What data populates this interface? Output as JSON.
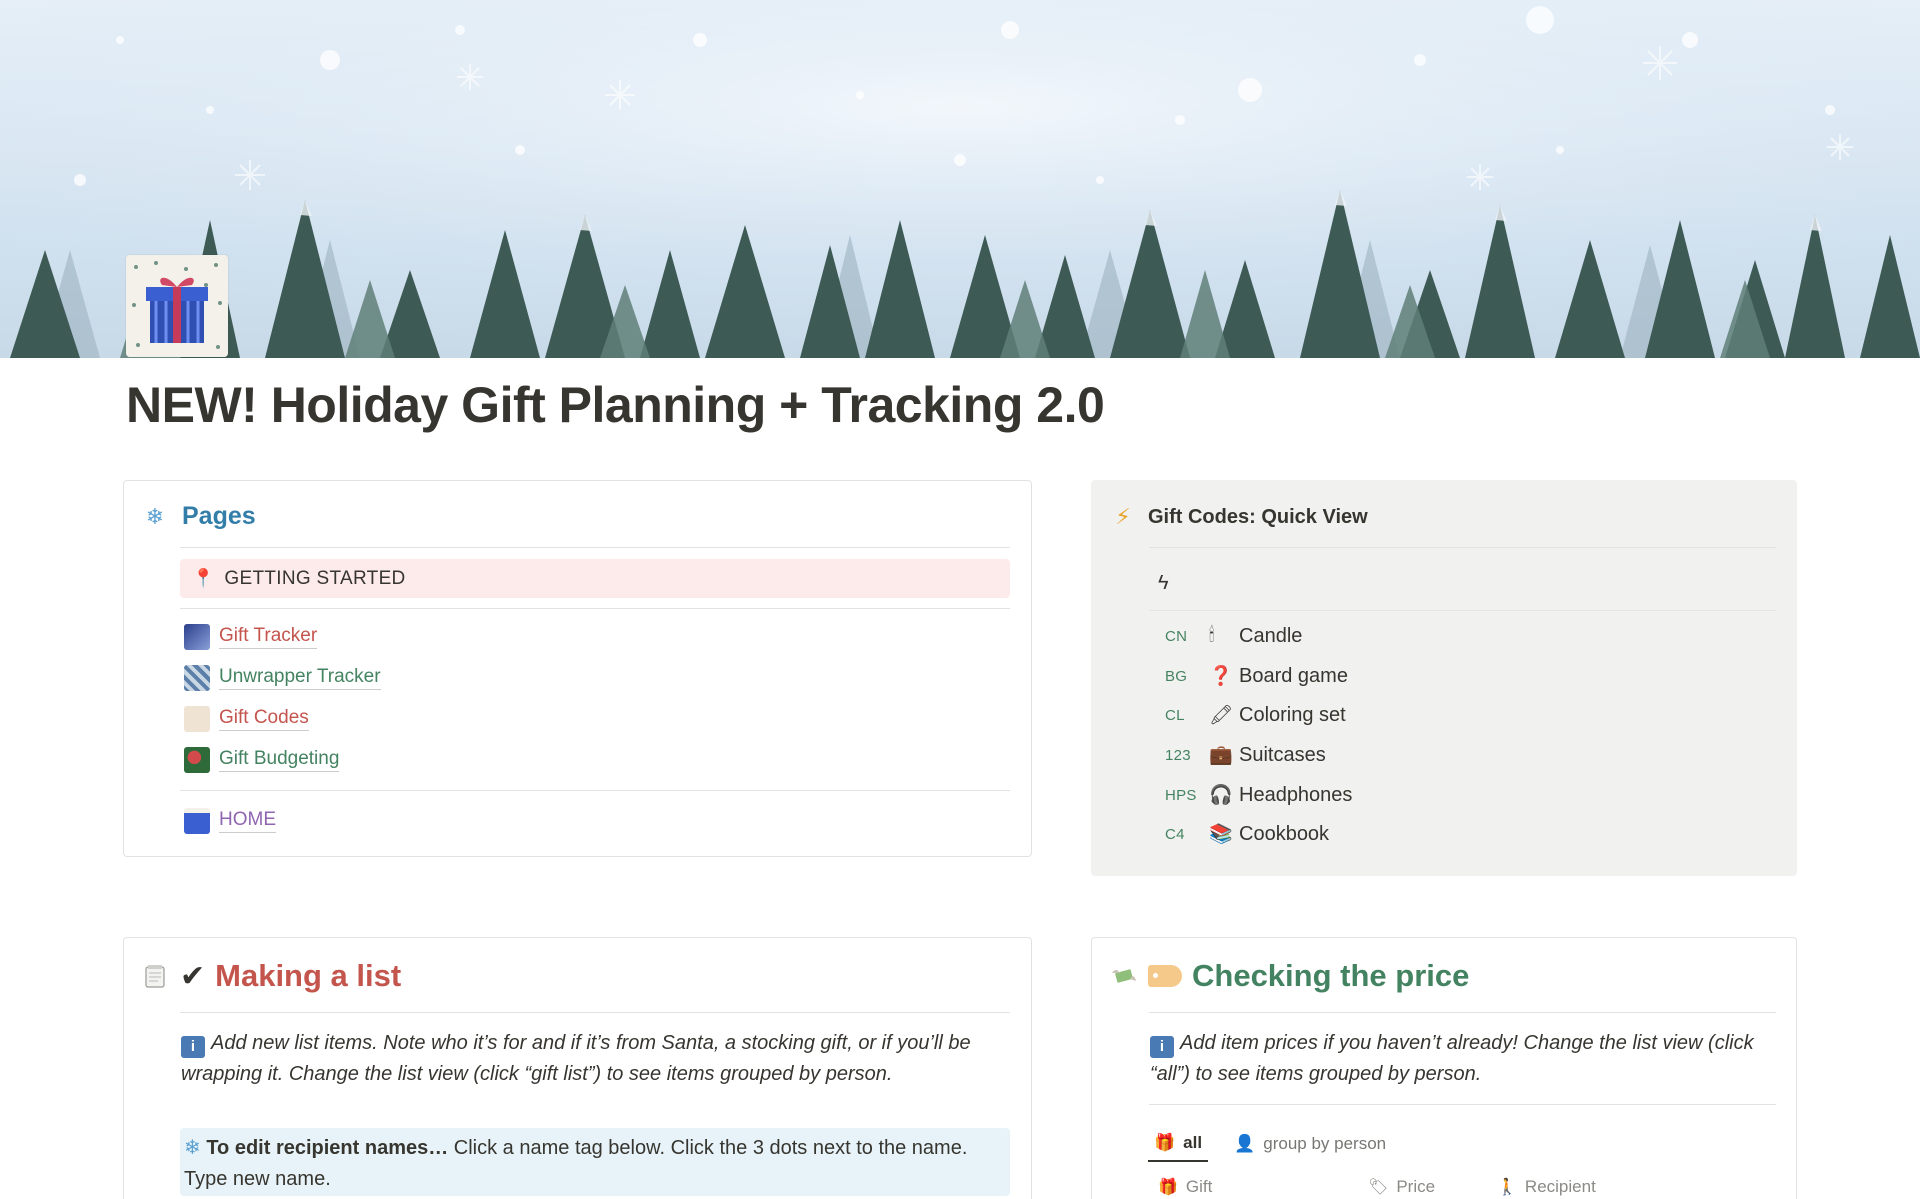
{
  "page": {
    "title": "NEW! Holiday Gift Planning + Tracking 2.0",
    "icon": "gift-icon"
  },
  "pages_card": {
    "title": "Pages",
    "icon": "snowflake-icon",
    "getting_started": "GETTING STARTED",
    "links": [
      {
        "label": "Gift Tracker",
        "icon": "gift-tracker-thumb-icon",
        "color": "#c4554d"
      },
      {
        "label": "Unwrapper Tracker",
        "icon": "unwrapper-thumb-icon",
        "color": "#448361"
      },
      {
        "label": "Gift Codes",
        "icon": "gift-codes-thumb-icon",
        "color": "#c4554d"
      },
      {
        "label": "Gift Budgeting",
        "icon": "gift-budgeting-thumb-icon",
        "color": "#448361"
      }
    ],
    "home": "HOME"
  },
  "codes_card": {
    "title": "Gift Codes: Quick View",
    "icon": "lightning-icon",
    "rows": [
      {
        "code": "CN",
        "emoji": "🕯",
        "icon": "candle-icon",
        "name": "Candle"
      },
      {
        "code": "BG",
        "emoji": "❓",
        "icon": "question-icon",
        "name": "Board game"
      },
      {
        "code": "CL",
        "emoji": "🖍",
        "icon": "crayon-icon",
        "name": "Coloring set"
      },
      {
        "code": "123",
        "emoji": "💼",
        "icon": "suitcase-icon",
        "name": "Suitcases"
      },
      {
        "code": "HPS",
        "emoji": "🎧",
        "icon": "headphones-icon",
        "name": "Headphones"
      },
      {
        "code": "C4",
        "emoji": "📚",
        "icon": "books-icon",
        "name": "Cookbook"
      }
    ]
  },
  "list_card": {
    "title": "Making a list",
    "check": "✔",
    "info_badge": "i",
    "note": "Add new list items. Note who it’s for and if it’s from Santa, a stocking gift, or if you’ll be wrapping it. Change the list view (click “gift list”) to see items grouped by person.",
    "callout_bold": "To edit recipient names…",
    "callout_text": " Click a name tag below. Click the 3 dots next to the name. Type new name."
  },
  "price_card": {
    "title": "Checking the price",
    "info_badge": "i",
    "note": "Add item prices if you haven’t already! Change the list view (click “all”) to see items grouped by person.",
    "tabs": [
      {
        "label": "all",
        "icon": "gift-icon",
        "active": true
      },
      {
        "label": "group by person",
        "icon": "person-icon",
        "active": false
      }
    ],
    "columns": [
      {
        "label": "Gift",
        "icon": "gift-column-icon"
      },
      {
        "label": "Price",
        "icon": "tag-icon"
      },
      {
        "label": "Recipient",
        "icon": "person-walking-icon"
      }
    ]
  }
}
